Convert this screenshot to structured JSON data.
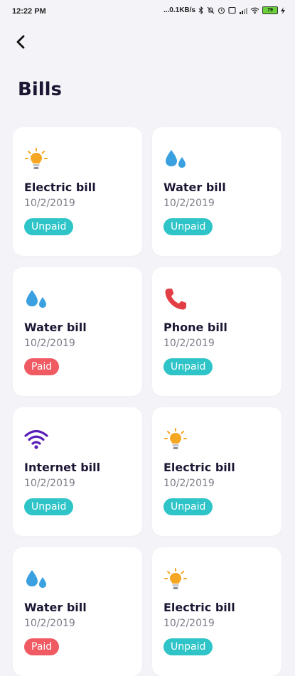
{
  "status_bar": {
    "time": "12:22 PM",
    "network_speed": "...0.1KB/s",
    "battery_level": "79"
  },
  "header": {
    "title": "Bills"
  },
  "colors": {
    "unpaid": "#2ec4c8",
    "paid": "#ef5a63",
    "electric_icon": "#f5a623",
    "water_icon": "#3aa0e0",
    "phone_icon": "#e23e45",
    "internet_icon": "#5a1fb8"
  },
  "bills": [
    {
      "name": "Electric bill",
      "date": "10/2/2019",
      "status": "Unpaid",
      "icon": "lightbulb-icon"
    },
    {
      "name": "Water bill",
      "date": "10/2/2019",
      "status": "Unpaid",
      "icon": "water-drops-icon"
    },
    {
      "name": "Water bill",
      "date": "10/2/2019",
      "status": "Paid",
      "icon": "water-drops-icon"
    },
    {
      "name": "Phone bill",
      "date": "10/2/2019",
      "status": "Unpaid",
      "icon": "phone-icon"
    },
    {
      "name": "Internet bill",
      "date": "10/2/2019",
      "status": "Unpaid",
      "icon": "wifi-icon"
    },
    {
      "name": "Electric bill",
      "date": "10/2/2019",
      "status": "Unpaid",
      "icon": "lightbulb-icon"
    },
    {
      "name": "Water bill",
      "date": "10/2/2019",
      "status": "Paid",
      "icon": "water-drops-icon"
    },
    {
      "name": "Electric bill",
      "date": "10/2/2019",
      "status": "Unpaid",
      "icon": "lightbulb-icon"
    }
  ]
}
